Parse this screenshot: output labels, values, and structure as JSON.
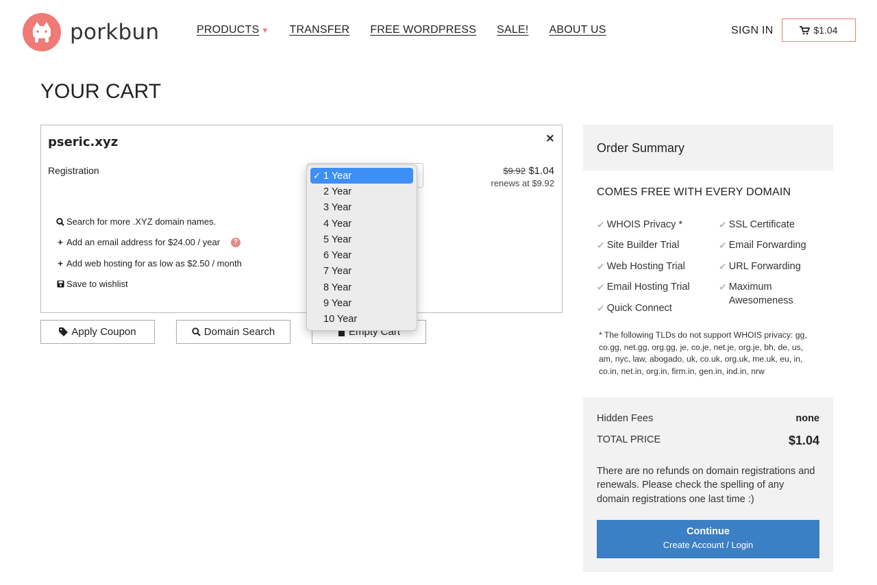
{
  "header": {
    "brand": "porkbun",
    "nav": [
      {
        "label": "PRODUCTS"
      },
      {
        "label": "TRANSFER"
      },
      {
        "label": "FREE WORDPRESS"
      },
      {
        "label": "SALE!"
      },
      {
        "label": "ABOUT US"
      }
    ],
    "signin": "SIGN IN",
    "cart_total": "$1.04"
  },
  "page_title": "YOUR CART",
  "cart_item": {
    "domain": "pseric.xyz",
    "close": "×",
    "registration_label": "Registration",
    "old_price": "$9.92",
    "new_price": "$1.04",
    "renews": "renews at $9.92",
    "options": {
      "search": "Search for more .XYZ domain names.",
      "email": "Add an email address for $24.00 / year",
      "hosting": "Add web hosting for as low as $2.50 / month",
      "wishlist": "Save to wishlist"
    },
    "help_glyph": "?"
  },
  "term_dropdown": {
    "selected": "1 Year",
    "check": "✓",
    "options": [
      "1 Year",
      "2 Year",
      "3 Year",
      "4 Year",
      "5 Year",
      "6 Year",
      "7 Year",
      "8 Year",
      "9 Year",
      "10 Year"
    ]
  },
  "buttons": {
    "apply_coupon": "Apply Coupon",
    "domain_search": "Domain Search",
    "empty_cart": "Empty Cart"
  },
  "summary": {
    "title": "Order Summary",
    "free_title": "COMES FREE WITH EVERY DOMAIN",
    "features_left": [
      "WHOIS Privacy *",
      "Site Builder Trial",
      "Web Hosting Trial",
      "Email Hosting Trial",
      "Quick Connect"
    ],
    "features_right": [
      "SSL Certificate",
      "Email Forwarding",
      "URL Forwarding",
      "Maximum Awesomeness"
    ],
    "note": "* The following TLDs do not support WHOIS privacy: gg, co.gg, net.gg, org.gg, je, co.je, net.je, org.je, bh, de, us, am, nyc, law, abogado, uk, co.uk, org.uk, me.uk, eu, in, co.in, net.in, org.in, firm.in, gen.in, ind.in, nrw",
    "hidden_fees_label": "Hidden Fees",
    "hidden_fees_value": "none",
    "total_label": "TOTAL PRICE",
    "total_value": "$1.04",
    "refund_note": "There are no refunds on domain registrations and renewals. Please check the spelling of any domain registrations one last time :)",
    "continue_label": "Continue",
    "continue_sub": "Create Account / Login"
  },
  "colors": {
    "brand_pink": "#ef7a76",
    "continue_blue": "#3b7fc4",
    "dropdown_highlight": "#3d8ff5"
  }
}
